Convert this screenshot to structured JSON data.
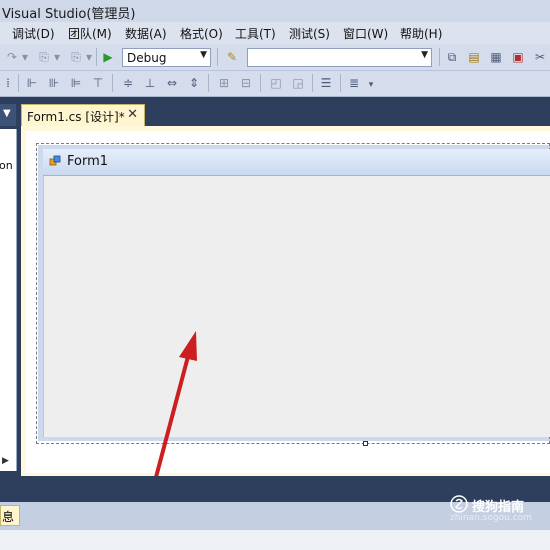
{
  "window": {
    "title": "Visual Studio(管理员)"
  },
  "menu": {
    "items": [
      "调试(D)",
      "团队(M)",
      "数据(A)",
      "格式(O)",
      "工具(T)",
      "测试(S)",
      "窗口(W)",
      "帮助(H)"
    ]
  },
  "toolbar": {
    "config_value": "Debug",
    "platform_value": ""
  },
  "toolbox": {
    "partial_label": "on"
  },
  "tab": {
    "label": "Form1.cs [设计]*",
    "close": "✕"
  },
  "form": {
    "title": "Form1"
  },
  "output": {
    "tab_label": "息"
  },
  "watermark": {
    "main": "搜狗指南",
    "sub": "zhinan.sogou.com"
  },
  "colors": {
    "arrow": "#cc1f1f",
    "tab_active": "#fff6cf",
    "workspace": "#2e3f5e"
  }
}
